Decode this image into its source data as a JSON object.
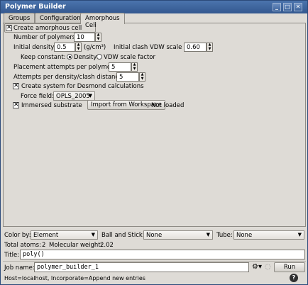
{
  "window": {
    "title": "Polymer Builder",
    "controls": {
      "minimize": "_",
      "maximize": "□",
      "close": "✕"
    }
  },
  "tabs": [
    {
      "label": "Groups"
    },
    {
      "label": "Configuration"
    },
    {
      "label": "Amorphous Cell"
    }
  ],
  "amorphous": {
    "create_label": "Create amorphous cell",
    "create_checked": true,
    "num_polymers_label": "Number of polymers",
    "num_polymers_value": "10",
    "initial_density_label": "Initial density",
    "initial_density_value": "0.5",
    "density_unit": "(g/cm³)",
    "clash_label": "Initial clash VDW scale factor",
    "clash_value": "0.60",
    "keep_constant_label": "Keep constant:",
    "density_radio_label": "Density",
    "vdw_radio_label": "VDW scale factor",
    "placement_label": "Placement attempts per polymer",
    "placement_value": "5",
    "attempts_label": "Attempts per density/clash distance",
    "attempts_value": "5",
    "desmond_label": "Create system for Desmond calculations",
    "desmond_checked": true,
    "force_field_label": "Force field:",
    "force_field_value": "OPLS_2005",
    "immersed_label": "Immersed substrate",
    "immersed_checked": true,
    "import_label": "Import from Workspace",
    "not_loaded_label": "Not loaded"
  },
  "bottom": {
    "color_by_label": "Color by:",
    "color_by_value": "Element",
    "ball_stick_label": "Ball and Stick:",
    "ball_stick_value": "None",
    "tube_label": "Tube:",
    "tube_value": "None",
    "total_atoms_label": "Total atoms:",
    "total_atoms_value": "2",
    "mol_weight_label": "Molecular weight:",
    "mol_weight_value": "2.02",
    "title_label": "Title:",
    "title_value": "poly()",
    "job_name_label": "Job name:",
    "job_name_value": "polymer_builder_1",
    "run_label": "Run",
    "status_text": "Host=localhost, Incorporate=Append new entries",
    "help_label": "?"
  }
}
